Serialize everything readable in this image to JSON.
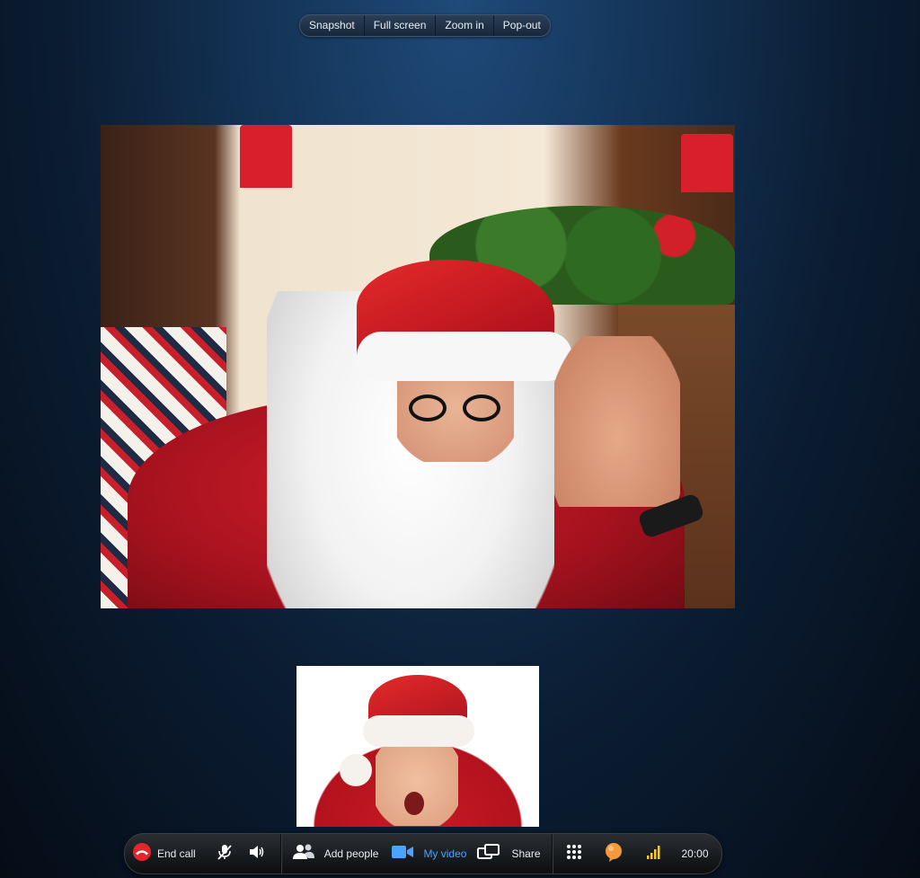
{
  "top_toolbar": {
    "snapshot": "Snapshot",
    "full_screen": "Full screen",
    "zoom_in": "Zoom in",
    "pop_out": "Pop-out"
  },
  "call_bar": {
    "end_call": "End call",
    "add_people": "Add people",
    "my_video": "My video",
    "share": "Share",
    "duration": "20:00"
  },
  "colors": {
    "end_call_red": "#e3262b",
    "my_video_blue": "#4aa3ff",
    "status_orange": "#f39a3c",
    "signal_yellow": "#f3c93a"
  },
  "icons": [
    "end-call-icon",
    "mute-mic-icon",
    "speaker-icon",
    "add-people-icon",
    "video-camera-icon",
    "share-screen-icon",
    "dialpad-icon",
    "chat-icon",
    "signal-strength-icon"
  ]
}
